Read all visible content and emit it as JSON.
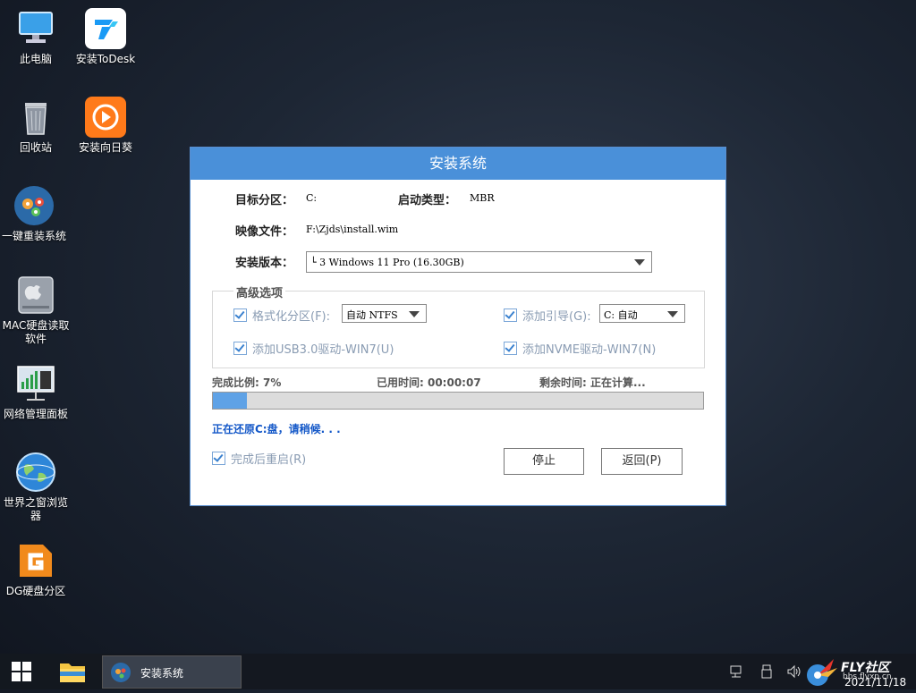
{
  "desktop": {
    "icons": [
      {
        "label": "此电脑"
      },
      {
        "label": "安装ToDesk"
      },
      {
        "label": "回收站"
      },
      {
        "label": "安装向日葵"
      },
      {
        "label": "一键重装系统"
      },
      {
        "label": "MAC硬盘读取软件"
      },
      {
        "label": "网络管理面板"
      },
      {
        "label": "世界之窗浏览器"
      },
      {
        "label": "DG硬盘分区"
      }
    ]
  },
  "dialog": {
    "title": "安装系统",
    "target_partition_label": "目标分区：",
    "target_partition_value": "C:",
    "boot_type_label": "启动类型：",
    "boot_type_value": "MBR",
    "image_file_label": "映像文件：",
    "image_file_value": "F:\\Zjds\\install.wim",
    "install_version_label": "安装版本：",
    "install_version_value": "└ 3 Windows 11 Pro (16.30GB)",
    "advanced_title": "高级选项",
    "format_partition_label": "格式化分区(F):",
    "format_partition_value": "自动 NTFS",
    "add_boot_label": "添加引导(G):",
    "add_boot_value": "C: 自动",
    "usb3_label": "添加USB3.0驱动-WIN7(U)",
    "nvme_label": "添加NVME驱动-WIN7(N)",
    "progress_ratio_label": "完成比例: 7%",
    "elapsed_label": "已用时间: 00:00:07",
    "remaining_label": "剩余时间: 正在计算...",
    "progress_fraction": 0.07,
    "restoring_text": "正在还原C:盘，请稍候. . .",
    "restart_label": "完成后重启(R)",
    "stop_button": "停止",
    "back_button": "返回(P)"
  },
  "taskbar": {
    "active_task": "安装系统",
    "watermark": "FLY社区",
    "watermark_url": "bbs.flyxp.cn",
    "date": "2021/11/18"
  },
  "colors": {
    "title_bar": "#4a90d9",
    "progress_fill": "#5fa2e6",
    "restoring_text": "#1458c8"
  }
}
